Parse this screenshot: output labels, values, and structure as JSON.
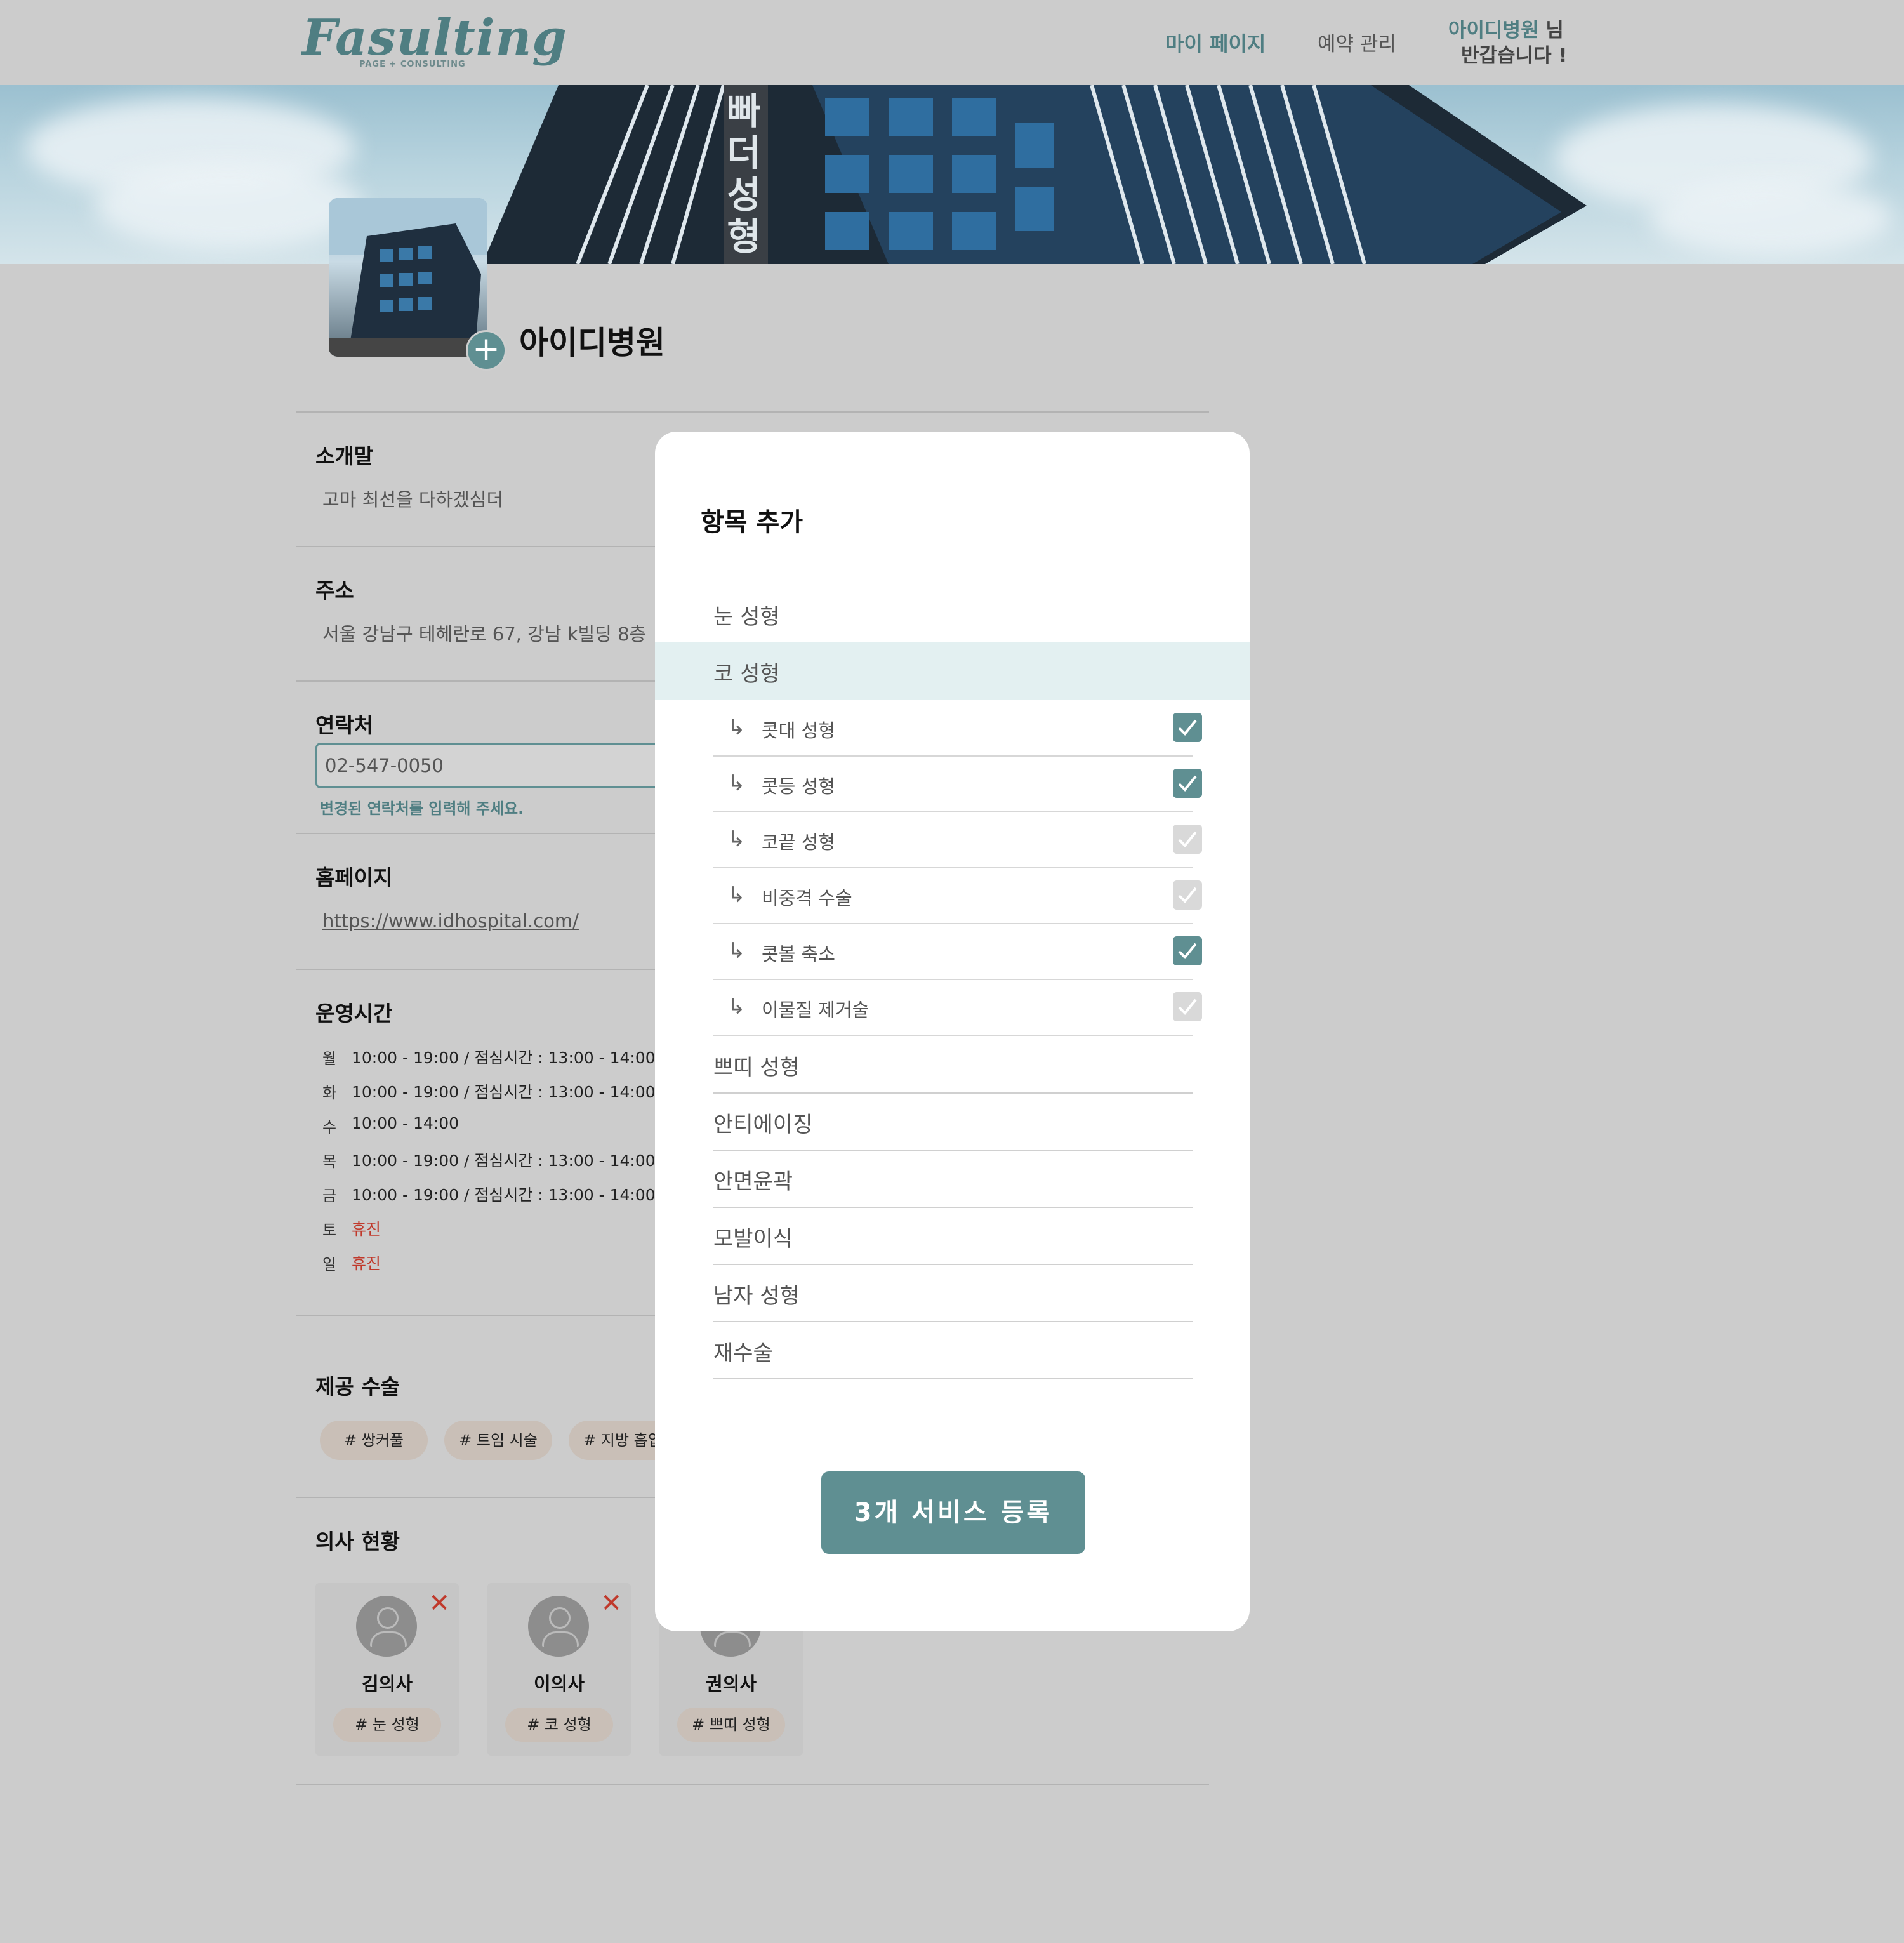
{
  "header": {
    "logo": "Fasulting",
    "logo_sub": "PAGE + CONSULTING",
    "nav": {
      "mypage": "마이 페이지",
      "reservation": "예약 관리"
    },
    "greeting": {
      "name": "아이디병원",
      "suffix": " 님",
      "line2": "반갑습니다 !"
    }
  },
  "banner": {
    "sign_text": "빠더성형"
  },
  "profile": {
    "hospital_name": "아이디병원"
  },
  "sections": {
    "intro": {
      "title": "소개말",
      "text": "고마 최선을 다하겠심더"
    },
    "address": {
      "title": "주소",
      "text": "서울 강남구 테헤란로 67, 강남 k빌딩 8층"
    },
    "contact": {
      "title": "연락처",
      "value": "02-547-0050",
      "helper": "변경된 연락처를 입력해 주세요."
    },
    "homepage": {
      "title": "홈페이지",
      "url": "https://www.idhospital.com/"
    },
    "hours": {
      "title": "운영시간",
      "rows": [
        {
          "day": "월",
          "text": "10:00 - 19:00 / 점심시간 : 13:00 - 14:00"
        },
        {
          "day": "화",
          "text": "10:00 - 19:00 / 점심시간 : 13:00 - 14:00"
        },
        {
          "day": "수",
          "text": "10:00 - 14:00"
        },
        {
          "day": "목",
          "text": "10:00 - 19:00 / 점심시간 : 13:00 - 14:00"
        },
        {
          "day": "금",
          "text": "10:00 - 19:00 / 점심시간 : 13:00 - 14:00"
        },
        {
          "day": "토",
          "text": "휴진"
        },
        {
          "day": "일",
          "text": "휴진"
        }
      ]
    },
    "services": {
      "title": "제공 수술",
      "tags": [
        "# 쌍커풀",
        "# 트임 시술",
        "# 지방 흡입"
      ]
    },
    "doctors": {
      "title": "의사 현황",
      "list": [
        {
          "name": "김의사",
          "tag": "# 눈 성형"
        },
        {
          "name": "이의사",
          "tag": "# 코 성형"
        },
        {
          "name": "권의사",
          "tag": "# 쁘띠 성형"
        }
      ]
    }
  },
  "modal": {
    "title": "항목 추가",
    "categories": {
      "eye": "눈 성형",
      "nose": "코 성형",
      "petit": "쁘띠 성형",
      "antiaging": "안티에이징",
      "facial": "안면윤곽",
      "hair": "모발이식",
      "men": "남자 성형",
      "revision": "재수술"
    },
    "nose_subitems": [
      {
        "label": "콧대 성형",
        "checked": true
      },
      {
        "label": "콧등 성형",
        "checked": true
      },
      {
        "label": "코끝 성형",
        "checked": false
      },
      {
        "label": "비중격 수술",
        "checked": false
      },
      {
        "label": "콧볼 축소",
        "checked": true
      },
      {
        "label": "이물질 제거술",
        "checked": false
      }
    ],
    "register_button": "3개 서비스 등록"
  },
  "colors": {
    "accent": "#5f8f92",
    "accent_text": "#4f7e82",
    "page_bg": "#cccccc",
    "closed_red": "#c0392b",
    "tag_bg": "#c9bfb7",
    "highlight_row": "#e3f0f1"
  },
  "icons": {
    "add_photo": "plus-icon",
    "sub_arrow": "return-arrow-icon",
    "check": "check-icon",
    "doctor_remove": "close-icon",
    "doctor_avatar": "user-icon"
  }
}
